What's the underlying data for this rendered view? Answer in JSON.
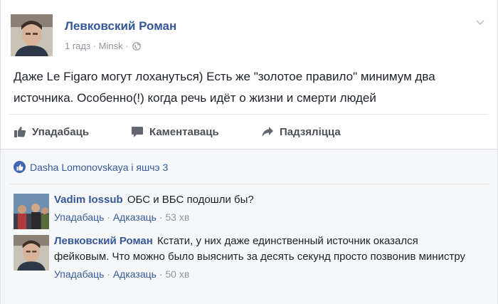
{
  "post": {
    "author": "Левковский Роман",
    "time": "1 гадз",
    "location": "Minsk",
    "meta_sep": "·",
    "text": "Даже Le Figaro могут лохануться) Есть же \"золотое правило\" минимум два источника. Особенно(!) когда речь идёт о жизни и смерти людей"
  },
  "actions": {
    "like": "Упадабаць",
    "comment": "Каментаваць",
    "share": "Падзяліцца"
  },
  "likes": {
    "text": "Dasha Lomonovskaya і яшчэ 3"
  },
  "comments": [
    {
      "author": "Vadim Iossub",
      "text": "ОБС и ВБС подошли бы?",
      "like": "Упадабаць",
      "reply": "Адказаць",
      "sep": "·",
      "time": "53 хв"
    },
    {
      "author": "Левковский Роман",
      "text": "Кстати, у них даже единственный источник оказался фейковым. Что можно было выяснить за десять секунд просто позвонив министру",
      "like": "Упадабаць",
      "reply": "Адказаць",
      "sep": "·",
      "time": "50 хв"
    }
  ],
  "colors": {
    "link": "#365899",
    "meta": "#90949c",
    "text": "#1d2129",
    "feedback_bg": "#f6f7f9",
    "brand": "#4267b2"
  },
  "icons": [
    "chevron-down-icon",
    "globe-icon",
    "like-icon",
    "comment-icon",
    "share-icon",
    "like-badge-icon"
  ]
}
